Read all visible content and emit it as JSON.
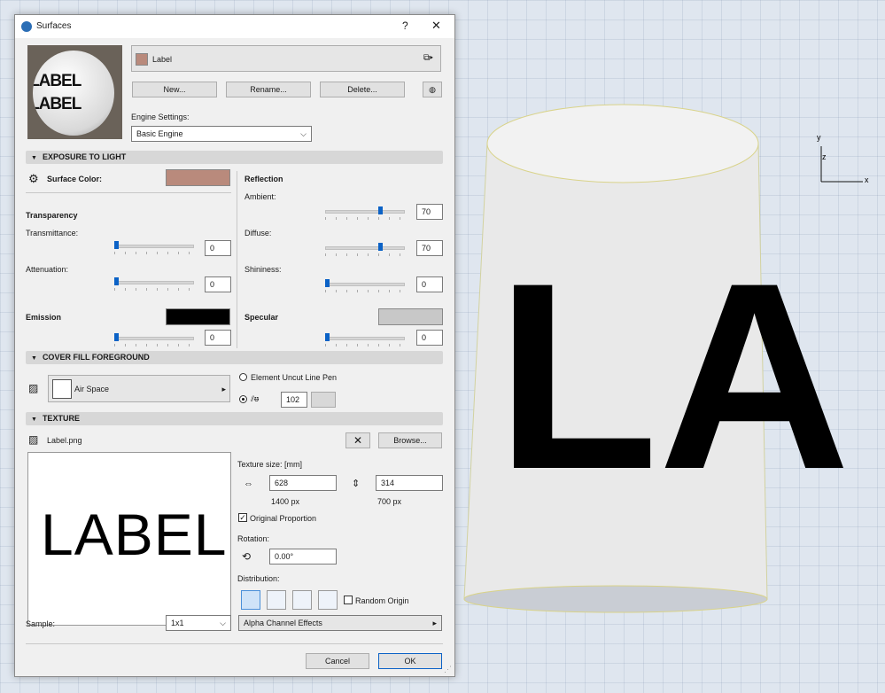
{
  "dialog": {
    "title": "Surfaces",
    "help": "?",
    "close": "✕",
    "surface_name": "Label",
    "buttons": {
      "new": "New...",
      "rename": "Rename...",
      "delete": "Delete..."
    },
    "preview_text": "LABEL LABEL",
    "engine_settings_label": "Engine Settings:",
    "engine_value": "Basic Engine"
  },
  "exposure": {
    "header": "EXPOSURE TO LIGHT",
    "surface_color_label": "Surface Color:",
    "surface_color": "#b98a7c",
    "transparency_label": "Transparency",
    "transmittance_label": "Transmittance:",
    "transmittance": "0",
    "attenuation_label": "Attenuation:",
    "attenuation": "0",
    "emission_label": "Emission",
    "emission": "0",
    "emission_color": "#000000",
    "reflection_label": "Reflection",
    "ambient_label": "Ambient:",
    "ambient": "70",
    "diffuse_label": "Diffuse:",
    "diffuse": "70",
    "shininess_label": "Shininess:",
    "shininess": "0",
    "specular_label": "Specular",
    "specular": "0",
    "specular_color": "#c8c8c8"
  },
  "cover_fill": {
    "header": "COVER FILL FOREGROUND",
    "fill_name": "Air Space",
    "uncut_label": "Element Uncut Line Pen",
    "pen_value": "102"
  },
  "texture": {
    "header": "TEXTURE",
    "file": "Label.png",
    "browse": "Browse...",
    "preview_text": "LABEL",
    "size_label": "Texture size: [mm]",
    "width": "628",
    "height": "314",
    "width_px": "1400 px",
    "height_px": "700 px",
    "orig_prop_label": "Original Proportion",
    "rotation_label": "Rotation:",
    "rotation": "0.00°",
    "distribution_label": "Distribution:",
    "random_origin_label": "Random Origin",
    "sample_label": "Sample:",
    "sample_value": "1x1",
    "alpha_label": "Alpha Channel Effects"
  },
  "footer": {
    "cancel": "Cancel",
    "ok": "OK"
  },
  "viewport": {
    "cylinder_text": "LA",
    "axis_x": "x",
    "axis_y": "y",
    "axis_z": "z"
  }
}
